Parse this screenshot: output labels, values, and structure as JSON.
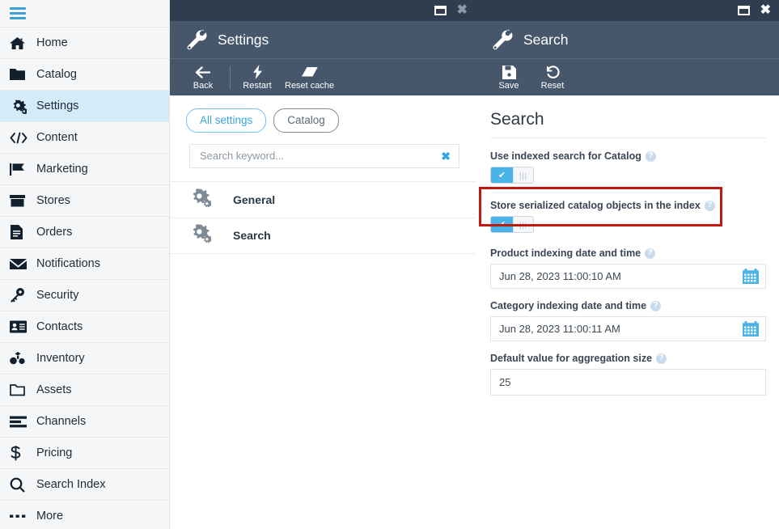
{
  "sidebar": {
    "menu_icon": "hamburger-menu-icon",
    "items": [
      {
        "label": "Home",
        "icon": "home-icon",
        "active": false
      },
      {
        "label": "Catalog",
        "icon": "folder-filled-icon",
        "active": false
      },
      {
        "label": "Settings",
        "icon": "gears-icon",
        "active": true
      },
      {
        "label": "Content",
        "icon": "code-brackets-icon",
        "active": false
      },
      {
        "label": "Marketing",
        "icon": "flag-icon",
        "active": false
      },
      {
        "label": "Stores",
        "icon": "store-box-icon",
        "active": false
      },
      {
        "label": "Orders",
        "icon": "document-list-icon",
        "active": false
      },
      {
        "label": "Notifications",
        "icon": "envelope-icon",
        "active": false
      },
      {
        "label": "Security",
        "icon": "key-icon",
        "active": false
      },
      {
        "label": "Contacts",
        "icon": "contact-card-icon",
        "active": false
      },
      {
        "label": "Inventory",
        "icon": "boxes-icon",
        "active": false
      },
      {
        "label": "Assets",
        "icon": "folder-outline-icon",
        "active": false
      },
      {
        "label": "Channels",
        "icon": "bars-list-icon",
        "active": false
      },
      {
        "label": "Pricing",
        "icon": "dollar-sign-icon",
        "active": false
      },
      {
        "label": "Search Index",
        "icon": "magnifier-icon",
        "active": false
      },
      {
        "label": "More",
        "icon": "ellipsis-icon",
        "active": false
      }
    ]
  },
  "settings_panel": {
    "window": {
      "maximize": "maximize-icon",
      "close": "close-icon"
    },
    "title": "Settings",
    "title_icon": "wrench-icon",
    "toolbar": [
      {
        "label": "Back",
        "icon": "arrow-left-icon"
      },
      {
        "label": "Restart",
        "icon": "lightning-bolt-icon"
      },
      {
        "label": "Reset cache",
        "icon": "eraser-icon"
      }
    ],
    "filters": [
      {
        "label": "All settings",
        "active": true
      },
      {
        "label": "Catalog",
        "active": false
      }
    ],
    "search": {
      "value": "",
      "placeholder": "Search keyword...",
      "clear_icon": "clear-x-icon"
    },
    "list": [
      {
        "label": "General",
        "icon": "gears-icon"
      },
      {
        "label": "Search",
        "icon": "gears-icon"
      }
    ]
  },
  "search_panel": {
    "window": {
      "maximize": "maximize-icon",
      "close": "close-icon"
    },
    "title": "Search",
    "title_icon": "wrench-icon",
    "toolbar": [
      {
        "label": "Save",
        "icon": "floppy-disk-icon"
      },
      {
        "label": "Reset",
        "icon": "undo-arrow-icon"
      }
    ],
    "heading": "Search",
    "fields": [
      {
        "label": "Use indexed search for Catalog",
        "type": "toggle",
        "value": "on",
        "help": "?",
        "check": "✔",
        "handle": "|||"
      },
      {
        "label": "Store serialized catalog objects in the index",
        "type": "toggle",
        "value": "on",
        "help": "?",
        "check": "✔",
        "handle": "|||",
        "highlighted": true
      },
      {
        "label": "Product indexing date and time",
        "type": "datetime",
        "value": "Jun 28, 2023 11:00:10 AM",
        "help": "?",
        "calendar_icon": "calendar-icon"
      },
      {
        "label": "Category indexing date and time",
        "type": "datetime",
        "value": "Jun 28, 2023 11:00:11 AM",
        "help": "?",
        "calendar_icon": "calendar-icon"
      },
      {
        "label": "Default value for aggregation size",
        "type": "number",
        "value": "25",
        "help": "?"
      }
    ]
  },
  "colors": {
    "window_bar": "#2f3d4e",
    "title_bar": "#47576b",
    "accent_blue": "#35a5e0",
    "toggle_on": "#4ab4e8",
    "sidebar_active": "#d3ecf8",
    "highlight_box": "#c01a10"
  }
}
